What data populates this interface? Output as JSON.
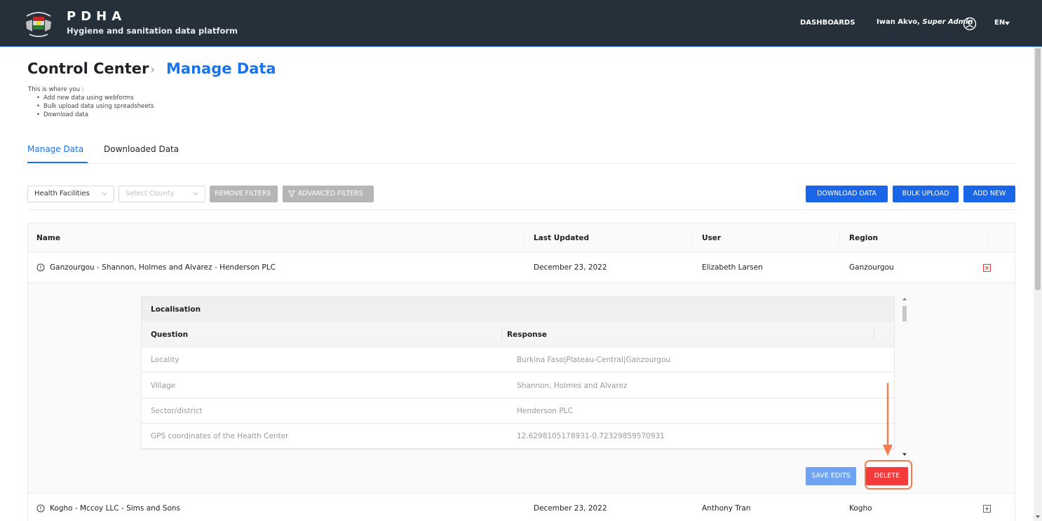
{
  "header": {
    "brand_title": "PDHA",
    "brand_subtitle": "Hygiene and sanitation data platform",
    "nav_dashboards": "DASHBOARDS",
    "user_name": "Iwan Akvo,",
    "user_role": "Super Admin",
    "language": "EN",
    "icons": [
      "logo-emblem",
      "user-circle-icon",
      "caret-down-icon"
    ]
  },
  "page": {
    "title": "Control Center",
    "breadcrumb_separator": "›",
    "subtitle": "Manage Data",
    "intro": "This is where you :",
    "bullets": [
      "Add new data using webforms",
      "Bulk upload data using spreadsheets",
      "Download data"
    ]
  },
  "tabs": [
    {
      "label": "Manage Data",
      "active": true
    },
    {
      "label": "Downloaded Data",
      "active": false
    }
  ],
  "filters": {
    "form_select": "Health Facilities",
    "county_placeholder": "Select County",
    "remove_filters": "REMOVE FILTERS",
    "advanced_filters": "ADVANCED FILTERS",
    "download_data": "DOWNLOAD DATA",
    "bulk_upload": "BULK UPLOAD",
    "add_new": "ADD NEW"
  },
  "table": {
    "columns": [
      "Name",
      "Last Updated",
      "User",
      "Region"
    ],
    "rows": [
      {
        "name": "Ganzourgou - Shannon, Holmes and Alvarez - Henderson PLC",
        "last_updated": "December 23, 2022",
        "user": "Elizabeth Larsen",
        "region": "Ganzourgou",
        "expanded": true
      },
      {
        "name": "Kogho - Mccoy LLC - Sims and Sons",
        "last_updated": "December 23, 2022",
        "user": "Anthony Tran",
        "region": "Kogho",
        "expanded": false
      }
    ]
  },
  "detail": {
    "group": "Localisation",
    "question_header": "Question",
    "response_header": "Response",
    "rows": [
      {
        "question": "Locality",
        "response": "Burkina Faso|Plateau-Central|Ganzourgou"
      },
      {
        "question": "Village",
        "response": "Shannon, Holmes and Alvarez"
      },
      {
        "question": "Sector/district",
        "response": "Henderson PLC"
      },
      {
        "question": "GPS coordinates of the Health Center",
        "response": "12.6298105178931-0.72329859570931"
      }
    ],
    "save_edits": "SAVE EDITS",
    "delete": "DELETE"
  },
  "colors": {
    "header_bg": "#25303a",
    "primary": "#1a66e8",
    "danger": "#f33b3b",
    "highlight": "#f57c4e"
  }
}
